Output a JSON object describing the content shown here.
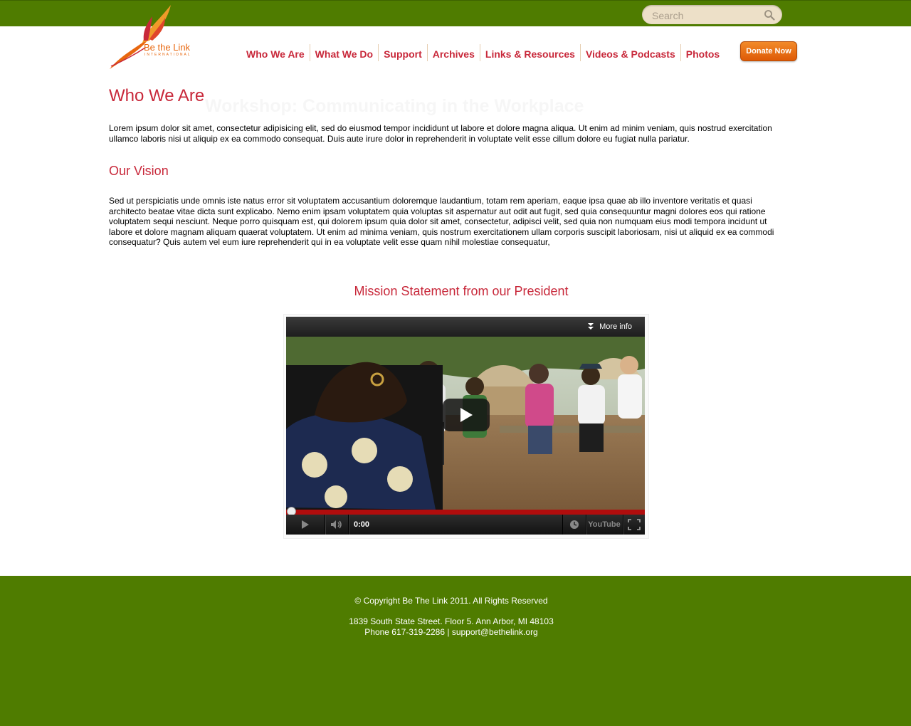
{
  "header": {
    "search_placeholder": "Search",
    "logo_text": "Be the Link",
    "logo_subtext": "INTERNATIONAL"
  },
  "nav": {
    "items": [
      {
        "label": "Who We Are"
      },
      {
        "label": "What We Do"
      },
      {
        "label": "Support"
      },
      {
        "label": "Archives"
      },
      {
        "label": "Links & Resources"
      },
      {
        "label": "Videos & Podcasts"
      },
      {
        "label": "Photos"
      }
    ],
    "donate_label": "Donate Now"
  },
  "main": {
    "ghost_text": "Workshop: Communicating in the Workplace",
    "title": "Who We Are",
    "intro": "Lorem ipsum dolor sit amet, consectetur adipisicing elit, sed do eiusmod tempor incididunt ut labore et dolore magna aliqua. Ut enim ad minim veniam, quis nostrud exercitation ullamco laboris nisi ut aliquip ex ea commodo consequat. Duis aute irure dolor in reprehenderit in voluptate velit esse cillum dolore eu fugiat nulla pariatur.",
    "vision_title": "Our Vision",
    "vision_text": "Sed ut perspiciatis unde omnis iste natus error sit voluptatem accusantium doloremque laudantium, totam rem aperiam, eaque ipsa quae ab illo inventore veritatis et quasi architecto beatae vitae dicta sunt explicabo. Nemo enim ipsam voluptatem quia voluptas sit aspernatur aut odit aut fugit, sed quia consequuntur magni dolores eos qui ratione voluptatem sequi nesciunt. Neque porro quisquam est, qui dolorem ipsum quia dolor sit amet, consectetur, adipisci velit, sed quia non numquam eius modi tempora incidunt ut labore et dolore magnam aliquam quaerat voluptatem. Ut enim ad minima veniam, quis nostrum exercitationem ullam corporis suscipit laboriosam, nisi ut aliquid ex ea commodi consequatur? Quis autem vel eum iure reprehenderit qui in ea voluptate velit esse quam nihil molestiae consequatur,",
    "mission_title": "Mission Statement from our President"
  },
  "video": {
    "more_info_label": "More info",
    "time": "0:00",
    "progress": 0,
    "youtube_label": "YouTube"
  },
  "footer": {
    "copyright": "© Copyright Be The Link 2011. All Rights Reserved",
    "address": "1839 South State Street. Floor 5. Ann Arbor, MI 48103",
    "contact": "Phone 617-319-2286 | support@bethelink.org"
  },
  "colors": {
    "brand_green": "#4f7c00",
    "accent_red": "#c8283a",
    "donate_orange": "#e8670f"
  }
}
